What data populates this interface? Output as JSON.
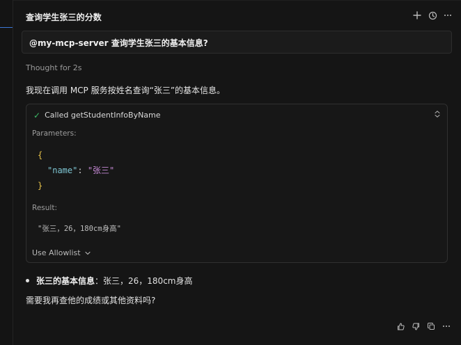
{
  "header": {
    "title": "查询学生张三的分数",
    "actions": [
      "plus-icon",
      "history-icon",
      "more-icon"
    ]
  },
  "prompt": {
    "text": "@my-mcp-server 查询学生张三的基本信息?"
  },
  "thought": {
    "text": "Thought for 2s"
  },
  "assistant": {
    "intro": "我现在调用 MCP 服务按姓名查询“张三”的基本信息。",
    "tool_call": {
      "status": "Called getStudentInfoByName",
      "parameters_label": "Parameters:",
      "json": {
        "open_brace": "{",
        "key": "\"name\"",
        "colon": ": ",
        "value": "\"张三\"",
        "close_brace": "}"
      },
      "result_label": "Result:",
      "result_value": "\"张三，26，180cm身高\"",
      "allowlist_label": "Use Allowlist"
    },
    "summary_label": "张三的基本信息",
    "summary_value": "：张三，26，180cm身高",
    "question": "需要我再查他的成绩或其他资料吗?"
  },
  "footer": {
    "actions": [
      "thumbs-up-icon",
      "thumbs-down-icon",
      "copy-icon",
      "more-icon"
    ]
  },
  "colors": {
    "background": "#151515",
    "card": "#171717",
    "border": "#303030",
    "success": "#3dbb67",
    "json_brace": "#e6c24a",
    "json_key": "#7fc7d4",
    "json_string": "#c689d6"
  }
}
